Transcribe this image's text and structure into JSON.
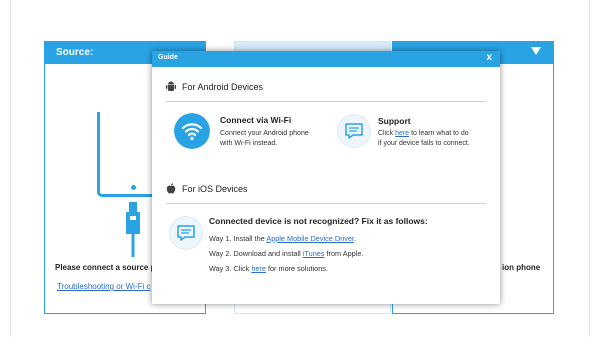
{
  "panels": {
    "source_title": "Source:",
    "connect_source_text": "Please connect a source ph",
    "troubleshoot_link": "Troubleshooting or Wi-Fi c",
    "dest_connect_text": "ion phone"
  },
  "dialog": {
    "title": "Guide",
    "close": "x",
    "android": {
      "section_title": "For Android Devices",
      "wifi": {
        "heading": "Connect via Wi-Fi",
        "line1": "Connect your Android phone",
        "line2": "with Wi-Fi instead."
      },
      "support": {
        "heading": "Support",
        "line1_pre": "Click ",
        "line1_link": "here",
        "line1_post": " to learn what to do",
        "line2": "if your device fails to connect."
      }
    },
    "ios": {
      "section_title": "For iOS Devices",
      "heading": "Connected device is not recognized? Fix it as follows:",
      "way1_pre": "Way 1. Install the ",
      "way1_link": "Apple Mobile Device Driver",
      "way1_post": ".",
      "way2_pre": "Way 2. Download and install ",
      "way2_link": "iTunes",
      "way2_post": " from Apple.",
      "way3_pre": "Way 3. Click ",
      "way3_link": "here",
      "way3_post": " for more solutions."
    }
  },
  "colors": {
    "accent": "#29a3e3",
    "link": "#2a6cc8"
  },
  "icons": {
    "android": "android-icon",
    "apple": "apple-icon",
    "wifi": "wifi-icon",
    "chat": "chat-bubble-icon",
    "dropdown": "chevron-down-icon",
    "phone": "phone-outline-icon",
    "usb": "usb-cable-icon"
  }
}
